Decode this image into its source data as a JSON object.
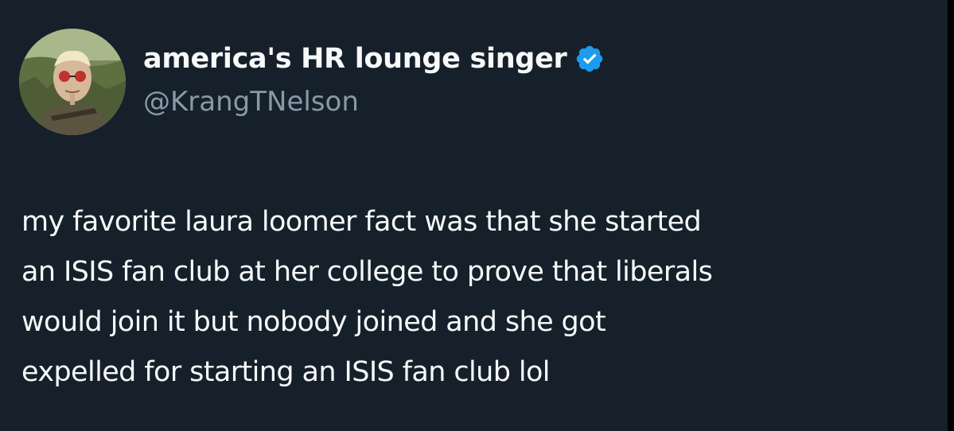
{
  "colors": {
    "background": "#15202b",
    "text": "#f7f9f9",
    "secondary_text": "#8b98a5",
    "verified": "#1d9bf0"
  },
  "author": {
    "display_name": "america's HR lounge singer",
    "handle": "@KrangTNelson",
    "verified_icon": "verified-badge-icon"
  },
  "tweet": {
    "lines": [
      "my favorite laura loomer fact was that she started",
      "an ISIS fan club at her college to prove that liberals",
      "would join it but nobody joined and she got",
      "expelled for starting an ISIS fan club lol"
    ]
  }
}
